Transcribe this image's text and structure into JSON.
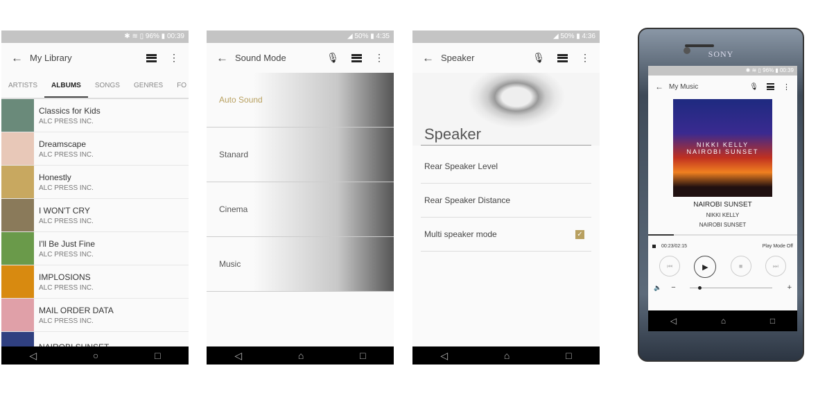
{
  "library": {
    "status": "✱ ≋ ▯ 96% ▮ 00:39",
    "title": "My Library",
    "tabs": [
      "ARTISTS",
      "ALBUMS",
      "SONGS",
      "GENRES",
      "FO"
    ],
    "albums": [
      {
        "title": "Classics for Kids",
        "sub": "ALC PRESS INC.",
        "c": "#6a8a7a"
      },
      {
        "title": "Dreamscape",
        "sub": "ALC PRESS INC.",
        "c": "#e8c8b8"
      },
      {
        "title": "Honestly",
        "sub": "ALC PRESS INC.",
        "c": "#c8a860"
      },
      {
        "title": "I WON'T CRY",
        "sub": "ALC PRESS INC.",
        "c": "#8a7a5a"
      },
      {
        "title": "I'll Be Just Fine",
        "sub": "ALC PRESS INC.",
        "c": "#6a9a4a"
      },
      {
        "title": "IMPLOSIONS",
        "sub": "ALC PRESS INC.",
        "c": "#d88a10"
      },
      {
        "title": "MAIL ORDER DATA",
        "sub": "ALC PRESS INC.",
        "c": "#e0a0a8"
      },
      {
        "title": "NAIROBI SUNSET",
        "sub": "",
        "c": "#304080"
      }
    ]
  },
  "sound": {
    "status": "◢ 50% ▮ 4:35",
    "title": "Sound Mode",
    "modes": [
      "Auto Sound",
      "Stanard",
      "Cinema",
      "Music"
    ],
    "accent": "#b8a060"
  },
  "speaker": {
    "status": "◢ 50% ▮ 4:36",
    "title": "Speaker",
    "heading": "Speaker",
    "items": [
      "Rear Speaker Level",
      "Rear Speaker Distance",
      "Multi speaker mode"
    ],
    "multi_checked": true
  },
  "phone": {
    "brand": "SONY",
    "status": "✱ ≋ ▯ 96% ▮ 00:39",
    "title": "My Music",
    "album_art_text": "NIKKI KELLY NAIROBI SUNSET",
    "track": "NAIROBI SUNSET",
    "artist": "NIKKI KELLY",
    "album": "NAIROBI SUNSET",
    "time": "00:23/02:15",
    "play_mode": "Play Mode Off",
    "progress": 0.17,
    "volume": 0.1
  }
}
